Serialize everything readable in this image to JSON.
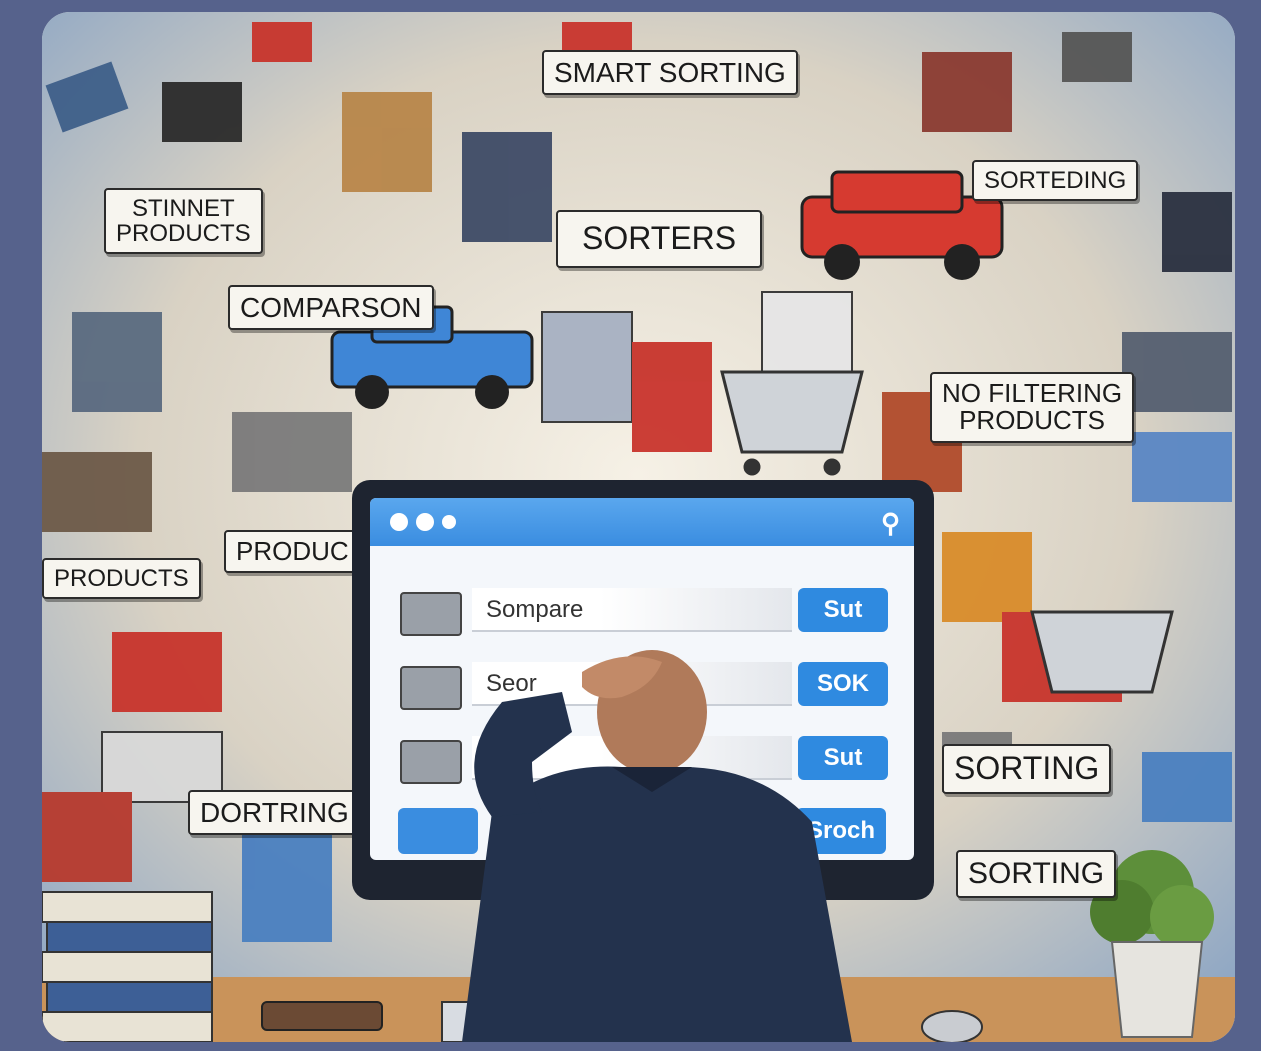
{
  "labels": {
    "smart_sorting": "SMART SORTING",
    "sorteding": "SORTEDING",
    "stinnet_products": "STINNET\nPRODUCTS",
    "sorters": "SORTERS",
    "comparson": "COMPARSON",
    "no_filtering_products": "NO FILTERING\nPRODUCTS",
    "products_left": "PRODUCTS",
    "produc": "PRODUC",
    "sorting_right": "SORTING",
    "dortring": "DORTRING",
    "sorting_bottom": "SORTING"
  },
  "browser": {
    "rows": [
      {
        "field": "Sompare",
        "button": "Sut"
      },
      {
        "field": "Seor",
        "button": "SOK"
      },
      {
        "field": "",
        "button": "Sut"
      }
    ],
    "bottom_button": "Sroch"
  },
  "colors": {
    "background": "#56628c",
    "accent": "#2f8ae0"
  },
  "icons": [
    "search-icon"
  ]
}
